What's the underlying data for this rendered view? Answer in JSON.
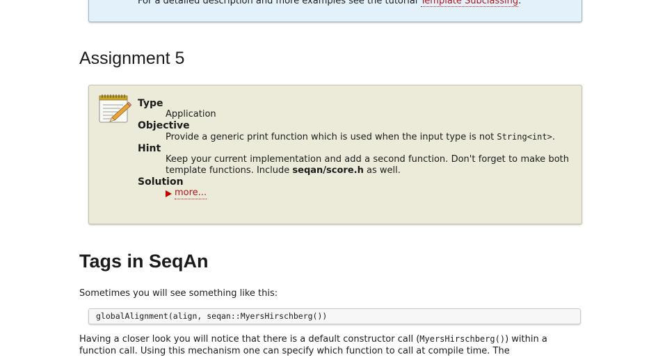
{
  "top_note": {
    "text_before": "For a detailed description and more examples see the tutorial ",
    "link": "Template Subclassing",
    "text_after": "."
  },
  "assignment": {
    "title": "Assignment 5",
    "icon": "notepad-pencil-icon",
    "type_label": "Type",
    "type_value": "Application",
    "objective_label": "Objective",
    "objective_text": "Provide a generic print function which is used when the input type is not",
    "objective_code": "String<int>",
    "objective_end": ".",
    "hint_label": "Hint",
    "hint_text": "Keep your current implementation and add a second function. Don't forget to make both template functions. Include ",
    "hint_file": "seqan/score.h",
    "hint_end": " as well.",
    "solution_label": "Solution",
    "more_label": "more..."
  },
  "tags_section": {
    "title": "Tags in SeqAn",
    "intro": "Sometimes you will see something like this:",
    "code": "globalAlignment(align, seqan::MyersHirschberg())",
    "para_before": "Having a closer look you will notice that there is a default constructor call (",
    "para_code": "MyersHirschberg()",
    "para_after": ") within a function call. Using this mechanism one can specify which function to call at compile time. The"
  },
  "colors": {
    "link": "#b0151d",
    "info_box_bg": "#e2f1fa",
    "task_box_bg": "#ecebda",
    "toggle_arrow": "#c00000"
  }
}
